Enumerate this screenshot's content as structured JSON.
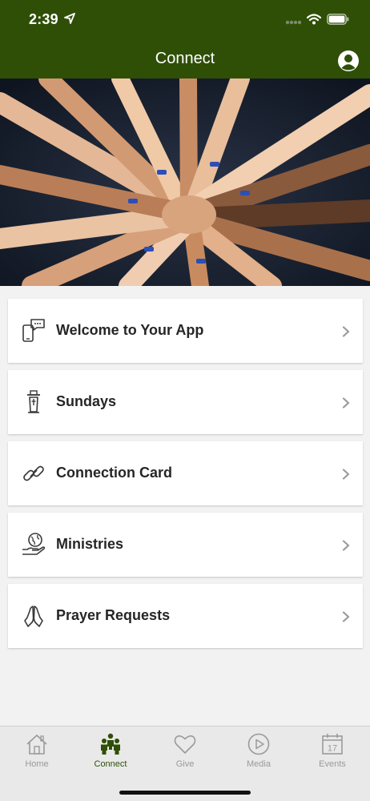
{
  "status_bar": {
    "time": "2:39"
  },
  "header": {
    "title": "Connect"
  },
  "menu": {
    "items": [
      {
        "label": "Welcome to Your App",
        "icon": "phone-chat-icon"
      },
      {
        "label": "Sundays",
        "icon": "pulpit-icon"
      },
      {
        "label": "Connection Card",
        "icon": "link-icon"
      },
      {
        "label": "Ministries",
        "icon": "globe-hand-icon"
      },
      {
        "label": "Prayer Requests",
        "icon": "praying-hands-icon"
      }
    ]
  },
  "tab_bar": {
    "tabs": [
      {
        "label": "Home",
        "icon": "home-icon",
        "active": false
      },
      {
        "label": "Connect",
        "icon": "people-icon",
        "active": true
      },
      {
        "label": "Give",
        "icon": "heart-icon",
        "active": false
      },
      {
        "label": "Media",
        "icon": "play-icon",
        "active": false
      },
      {
        "label": "Events",
        "icon": "calendar-icon",
        "active": false,
        "badge": "17"
      }
    ]
  },
  "colors": {
    "brand": "#2f4f07",
    "inactive": "#9a9a9a",
    "tab_bar_bg": "#e9e9e9"
  }
}
